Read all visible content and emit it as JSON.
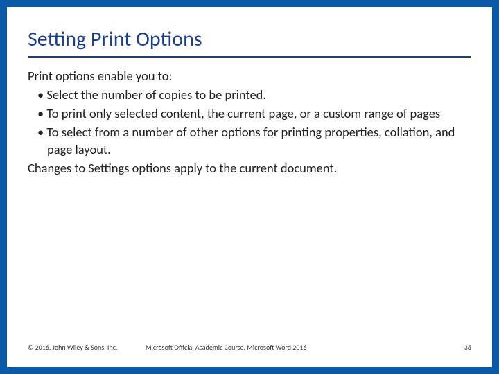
{
  "title": "Setting Print Options",
  "intro": "Print options enable you to:",
  "bullets": [
    "Select the number of copies to be printed.",
    "To print only selected content, the current page, or a custom range of pages",
    "To select from a number of other options for printing properties, collation, and page layout."
  ],
  "closing": "Changes to Settings options apply to the current document.",
  "footer": {
    "copyright": "© 2016, John Wiley & Sons, Inc.",
    "course": "Microsoft Official Academic Course, Microsoft Word 2016",
    "page": "36"
  }
}
